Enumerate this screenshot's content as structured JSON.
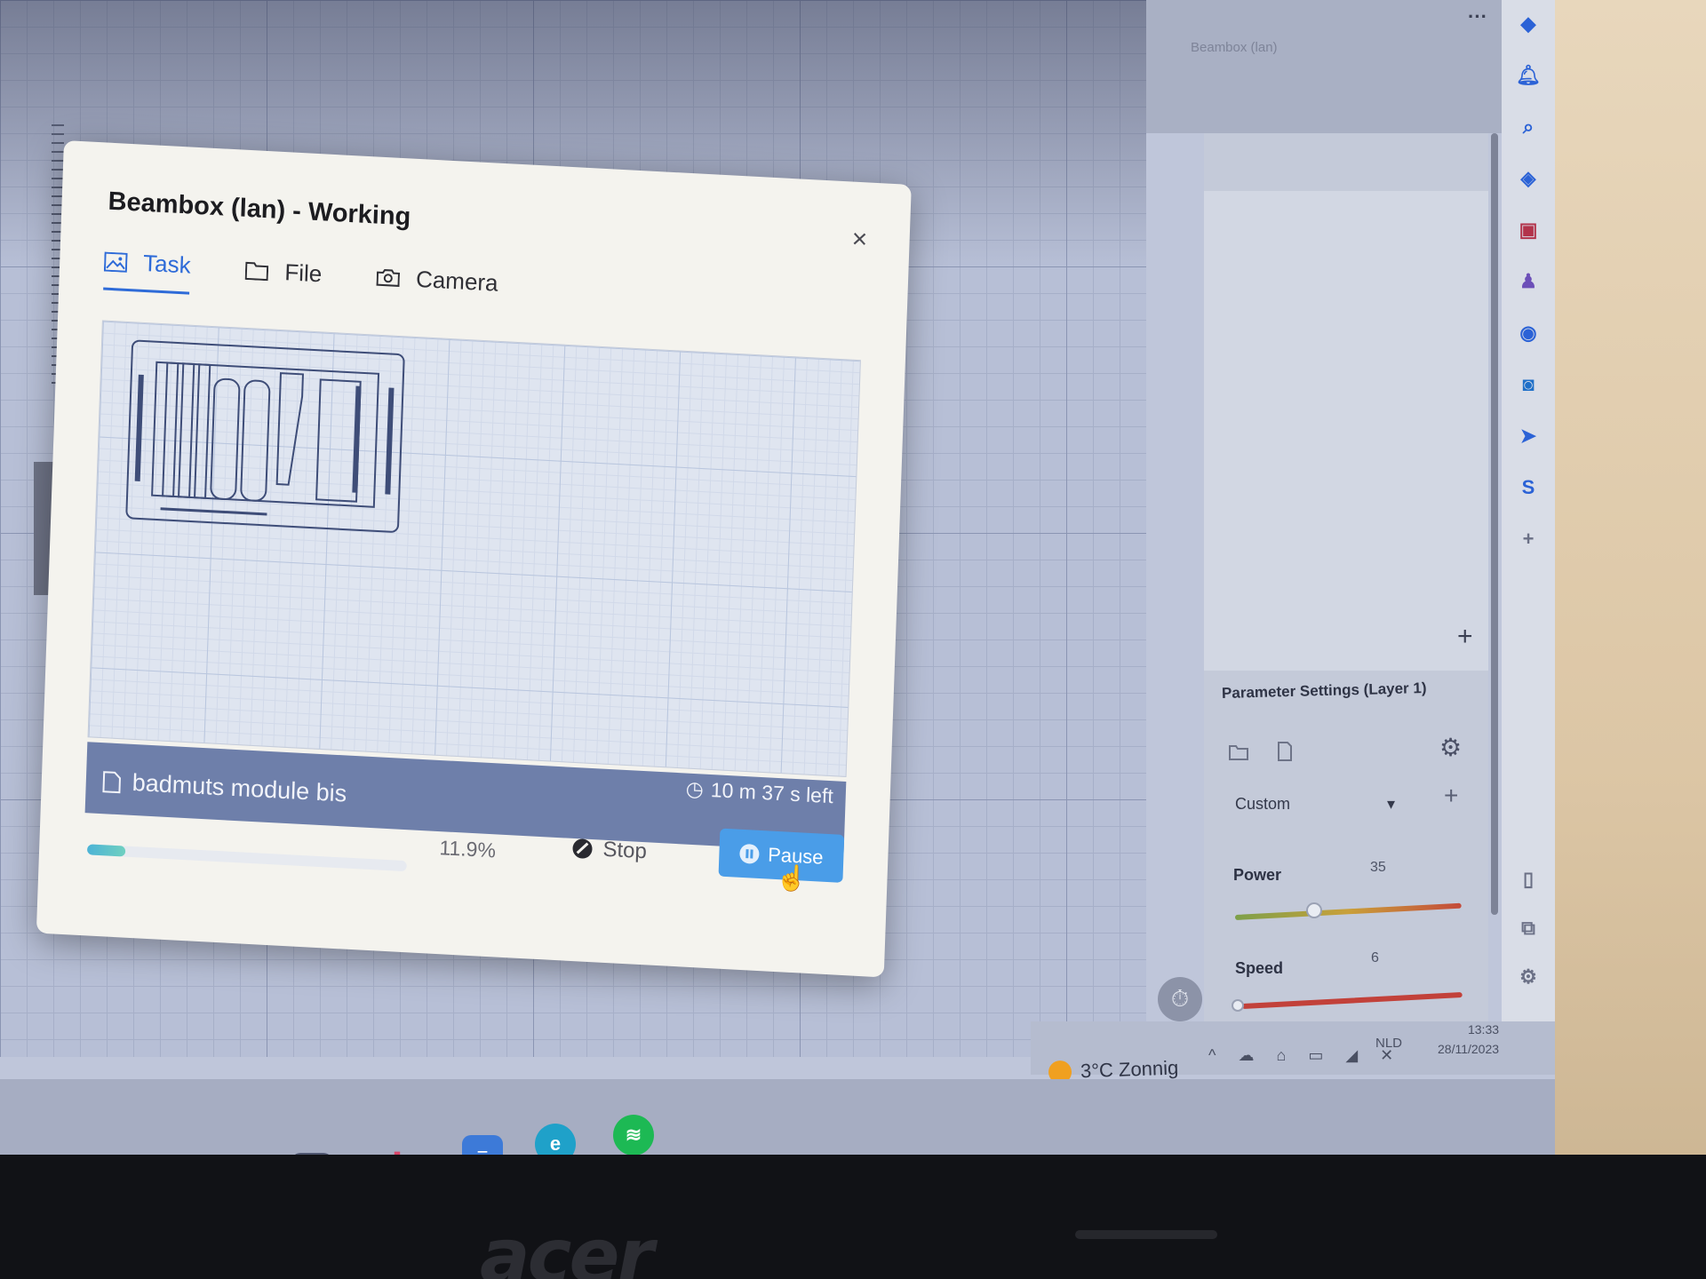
{
  "dialog": {
    "title": "Beambox (lan) - Working",
    "close_label": "×",
    "tabs": [
      {
        "label": "Task",
        "icon": "image-icon",
        "active": true
      },
      {
        "label": "File",
        "icon": "folder-icon",
        "active": false
      },
      {
        "label": "Camera",
        "icon": "camera-icon",
        "active": false
      }
    ],
    "job": {
      "file_name": "badmuts module bis",
      "time_left": "10 m 37 s left",
      "progress_text": "11.9%",
      "progress_fraction": 0.119
    },
    "buttons": {
      "stop_label": "Stop",
      "pause_label": "Pause"
    }
  },
  "app": {
    "window_title": "Beambox (lan)",
    "param_settings": {
      "title": "Parameter Settings (Layer 1)",
      "preset": "Custom",
      "power_label": "Power",
      "power_value": "35",
      "speed_label": "Speed",
      "speed_value": "6"
    }
  },
  "taskbar": {
    "weather": "3°C Zonnig",
    "language": "NLD",
    "time": "13:33",
    "date": "28/11/2023"
  },
  "device": {
    "brand": "acer"
  },
  "colors": {
    "accent": "#2e6bd8",
    "pause_button": "#4a9de8",
    "job_bar": "#6e7faa"
  }
}
